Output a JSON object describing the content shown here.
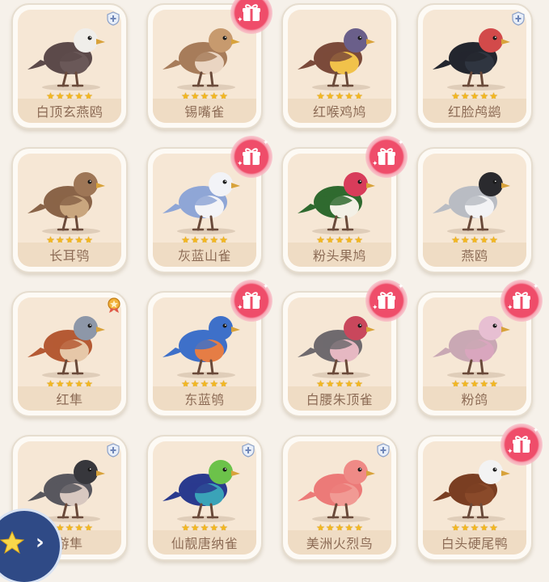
{
  "birds": [
    {
      "name": "白顶玄燕鸥",
      "rating": 5,
      "badge": "shield",
      "colors": {
        "body": "#5c4a4a",
        "head": "#f0eeea",
        "belly": "#6a5858"
      }
    },
    {
      "name": "锡嘴雀",
      "rating": 5,
      "badge": "gift",
      "colors": {
        "body": "#a77c5a",
        "head": "#c79a6e",
        "belly": "#ead5c2"
      }
    },
    {
      "name": "红喉鸡鸠",
      "rating": 5,
      "badge": "none",
      "colors": {
        "body": "#7b4a3a",
        "head": "#6a5f8a",
        "belly": "#f1c24a"
      }
    },
    {
      "name": "红脸鸬鹚",
      "rating": 5,
      "badge": "shield",
      "colors": {
        "body": "#23262e",
        "head": "#d24a4a",
        "belly": "#2f3540"
      }
    },
    {
      "name": "长耳鸮",
      "rating": 5,
      "badge": "none",
      "colors": {
        "body": "#8a6448",
        "head": "#9e7656",
        "belly": "#c9a67e"
      }
    },
    {
      "name": "灰蓝山雀",
      "rating": 5,
      "badge": "gift",
      "colors": {
        "body": "#8fa6d6",
        "head": "#f2f3f7",
        "belly": "#f4f4f7"
      }
    },
    {
      "name": "粉头果鸠",
      "rating": 5,
      "badge": "gift",
      "colors": {
        "body": "#2f6a2f",
        "head": "#d83c5a",
        "belly": "#f3f0e6"
      }
    },
    {
      "name": "燕鸥",
      "rating": 5,
      "badge": "none",
      "colors": {
        "body": "#b9bcc3",
        "head": "#2a2a2e",
        "belly": "#f3f3f5"
      }
    },
    {
      "name": "红隼",
      "rating": 5,
      "badge": "medal",
      "colors": {
        "body": "#b55a34",
        "head": "#8d97a8",
        "belly": "#e6c7a8"
      }
    },
    {
      "name": "东蓝鸲",
      "rating": 5,
      "badge": "gift",
      "colors": {
        "body": "#3e70c9",
        "head": "#3e70c9",
        "belly": "#e57d45"
      }
    },
    {
      "name": "白腰朱顶雀",
      "rating": 5,
      "badge": "gift",
      "colors": {
        "body": "#6f6a6e",
        "head": "#c9475c",
        "belly": "#e6b8c2"
      }
    },
    {
      "name": "粉鸽",
      "rating": 5,
      "badge": "gift",
      "colors": {
        "body": "#c9a8b4",
        "head": "#e7bfd2",
        "belly": "#d9a6be"
      }
    },
    {
      "name": "游隼",
      "rating": 5,
      "badge": "shield",
      "colors": {
        "body": "#58575e",
        "head": "#37373c",
        "belly": "#d8c8c0"
      }
    },
    {
      "name": "仙靓唐纳雀",
      "rating": 5,
      "badge": "shield",
      "colors": {
        "body": "#2a3a8e",
        "head": "#6cc24a",
        "belly": "#3aa3b8"
      }
    },
    {
      "name": "美洲火烈鸟",
      "rating": 5,
      "badge": "shield",
      "colors": {
        "body": "#ec7a78",
        "head": "#ef8a86",
        "belly": "#f19a94"
      }
    },
    {
      "name": "白头硬尾鸭",
      "rating": 5,
      "badge": "gift",
      "colors": {
        "body": "#7a3e22",
        "head": "#f3f3f3",
        "belly": "#8a4a2a"
      }
    }
  ],
  "colors": {
    "accent": "#ef4d6a",
    "star": "#f3b71f",
    "name_text": "#8d6c56",
    "card_bg": "#f6e7d5"
  },
  "icons": {
    "gift": "gift-icon",
    "shield": "shield-icon",
    "medal": "medal-icon",
    "star": "star-icon",
    "next": "chevron-right-icon"
  }
}
